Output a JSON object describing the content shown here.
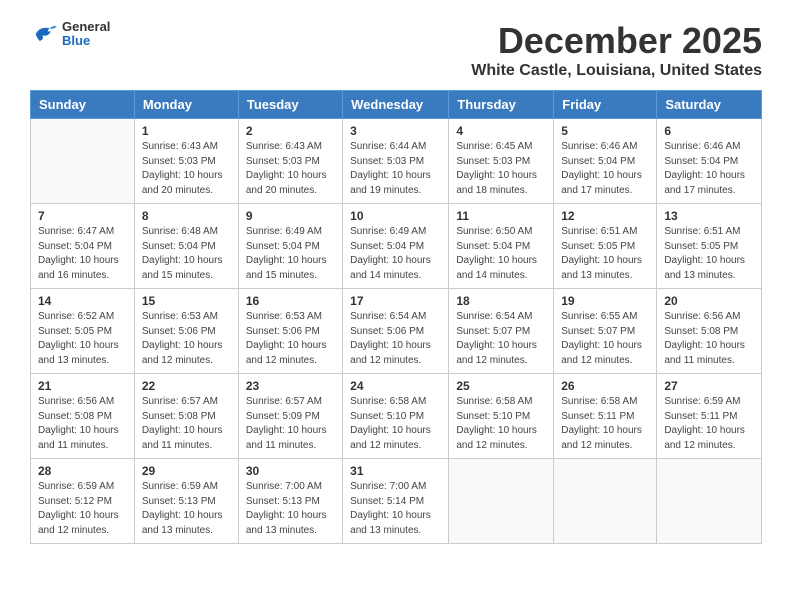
{
  "logo": {
    "general": "General",
    "blue": "Blue"
  },
  "title": "December 2025",
  "location": "White Castle, Louisiana, United States",
  "days_of_week": [
    "Sunday",
    "Monday",
    "Tuesday",
    "Wednesday",
    "Thursday",
    "Friday",
    "Saturday"
  ],
  "weeks": [
    [
      {
        "day": "",
        "info": ""
      },
      {
        "day": "1",
        "info": "Sunrise: 6:43 AM\nSunset: 5:03 PM\nDaylight: 10 hours\nand 20 minutes."
      },
      {
        "day": "2",
        "info": "Sunrise: 6:43 AM\nSunset: 5:03 PM\nDaylight: 10 hours\nand 20 minutes."
      },
      {
        "day": "3",
        "info": "Sunrise: 6:44 AM\nSunset: 5:03 PM\nDaylight: 10 hours\nand 19 minutes."
      },
      {
        "day": "4",
        "info": "Sunrise: 6:45 AM\nSunset: 5:03 PM\nDaylight: 10 hours\nand 18 minutes."
      },
      {
        "day": "5",
        "info": "Sunrise: 6:46 AM\nSunset: 5:04 PM\nDaylight: 10 hours\nand 17 minutes."
      },
      {
        "day": "6",
        "info": "Sunrise: 6:46 AM\nSunset: 5:04 PM\nDaylight: 10 hours\nand 17 minutes."
      }
    ],
    [
      {
        "day": "7",
        "info": "Sunrise: 6:47 AM\nSunset: 5:04 PM\nDaylight: 10 hours\nand 16 minutes."
      },
      {
        "day": "8",
        "info": "Sunrise: 6:48 AM\nSunset: 5:04 PM\nDaylight: 10 hours\nand 15 minutes."
      },
      {
        "day": "9",
        "info": "Sunrise: 6:49 AM\nSunset: 5:04 PM\nDaylight: 10 hours\nand 15 minutes."
      },
      {
        "day": "10",
        "info": "Sunrise: 6:49 AM\nSunset: 5:04 PM\nDaylight: 10 hours\nand 14 minutes."
      },
      {
        "day": "11",
        "info": "Sunrise: 6:50 AM\nSunset: 5:04 PM\nDaylight: 10 hours\nand 14 minutes."
      },
      {
        "day": "12",
        "info": "Sunrise: 6:51 AM\nSunset: 5:05 PM\nDaylight: 10 hours\nand 13 minutes."
      },
      {
        "day": "13",
        "info": "Sunrise: 6:51 AM\nSunset: 5:05 PM\nDaylight: 10 hours\nand 13 minutes."
      }
    ],
    [
      {
        "day": "14",
        "info": "Sunrise: 6:52 AM\nSunset: 5:05 PM\nDaylight: 10 hours\nand 13 minutes."
      },
      {
        "day": "15",
        "info": "Sunrise: 6:53 AM\nSunset: 5:06 PM\nDaylight: 10 hours\nand 12 minutes."
      },
      {
        "day": "16",
        "info": "Sunrise: 6:53 AM\nSunset: 5:06 PM\nDaylight: 10 hours\nand 12 minutes."
      },
      {
        "day": "17",
        "info": "Sunrise: 6:54 AM\nSunset: 5:06 PM\nDaylight: 10 hours\nand 12 minutes."
      },
      {
        "day": "18",
        "info": "Sunrise: 6:54 AM\nSunset: 5:07 PM\nDaylight: 10 hours\nand 12 minutes."
      },
      {
        "day": "19",
        "info": "Sunrise: 6:55 AM\nSunset: 5:07 PM\nDaylight: 10 hours\nand 12 minutes."
      },
      {
        "day": "20",
        "info": "Sunrise: 6:56 AM\nSunset: 5:08 PM\nDaylight: 10 hours\nand 11 minutes."
      }
    ],
    [
      {
        "day": "21",
        "info": "Sunrise: 6:56 AM\nSunset: 5:08 PM\nDaylight: 10 hours\nand 11 minutes."
      },
      {
        "day": "22",
        "info": "Sunrise: 6:57 AM\nSunset: 5:08 PM\nDaylight: 10 hours\nand 11 minutes."
      },
      {
        "day": "23",
        "info": "Sunrise: 6:57 AM\nSunset: 5:09 PM\nDaylight: 10 hours\nand 11 minutes."
      },
      {
        "day": "24",
        "info": "Sunrise: 6:58 AM\nSunset: 5:10 PM\nDaylight: 10 hours\nand 12 minutes."
      },
      {
        "day": "25",
        "info": "Sunrise: 6:58 AM\nSunset: 5:10 PM\nDaylight: 10 hours\nand 12 minutes."
      },
      {
        "day": "26",
        "info": "Sunrise: 6:58 AM\nSunset: 5:11 PM\nDaylight: 10 hours\nand 12 minutes."
      },
      {
        "day": "27",
        "info": "Sunrise: 6:59 AM\nSunset: 5:11 PM\nDaylight: 10 hours\nand 12 minutes."
      }
    ],
    [
      {
        "day": "28",
        "info": "Sunrise: 6:59 AM\nSunset: 5:12 PM\nDaylight: 10 hours\nand 12 minutes."
      },
      {
        "day": "29",
        "info": "Sunrise: 6:59 AM\nSunset: 5:13 PM\nDaylight: 10 hours\nand 13 minutes."
      },
      {
        "day": "30",
        "info": "Sunrise: 7:00 AM\nSunset: 5:13 PM\nDaylight: 10 hours\nand 13 minutes."
      },
      {
        "day": "31",
        "info": "Sunrise: 7:00 AM\nSunset: 5:14 PM\nDaylight: 10 hours\nand 13 minutes."
      },
      {
        "day": "",
        "info": ""
      },
      {
        "day": "",
        "info": ""
      },
      {
        "day": "",
        "info": ""
      }
    ]
  ]
}
